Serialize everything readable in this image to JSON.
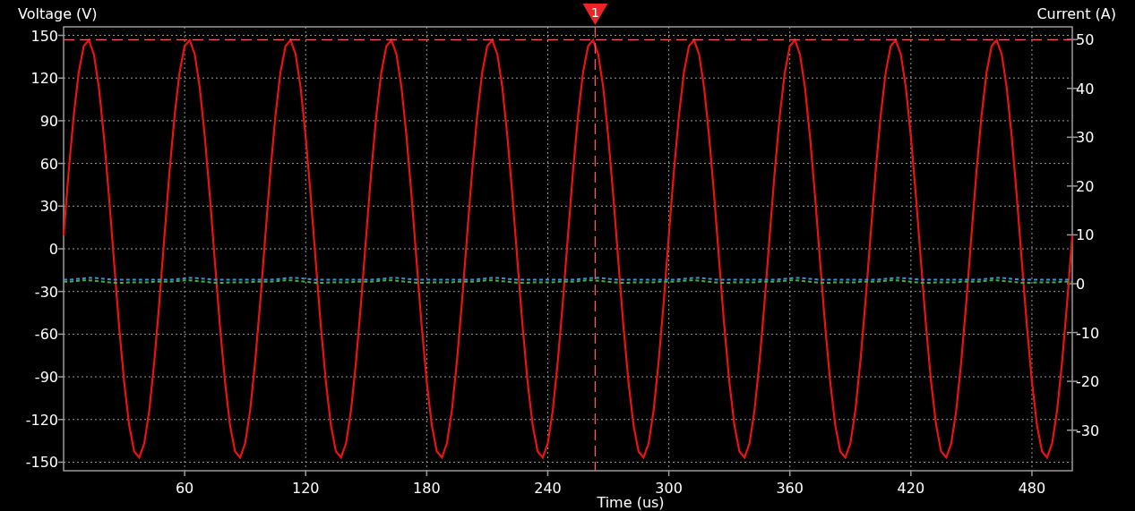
{
  "chart_data": {
    "type": "line",
    "grid": true,
    "ylabel": "Voltage (V)",
    "y2label": "Current (A)",
    "xlabel": "Time (us)",
    "xlim": [
      0,
      500
    ],
    "ylim": [
      -156,
      156
    ],
    "y2lim": [
      -38.3,
      52.6
    ],
    "xticks": [
      60,
      120,
      180,
      240,
      300,
      360,
      420,
      480
    ],
    "yticks": [
      -150,
      -120,
      -90,
      -60,
      -30,
      0,
      30,
      60,
      90,
      120,
      150
    ],
    "y2ticks": [
      -30,
      -20,
      -10,
      0,
      10,
      20,
      30,
      40,
      50
    ],
    "x": [
      0,
      2.5,
      5,
      7.5,
      10,
      12.5,
      15,
      17.5,
      20,
      22.5,
      25,
      27.5,
      30,
      32.5,
      35,
      37.5,
      40,
      42.5,
      45,
      47.5,
      50,
      52.5,
      55,
      57.5,
      60,
      62.5,
      65,
      67.5,
      70,
      72.5,
      75,
      77.5,
      80,
      82.5,
      85,
      87.5,
      90,
      92.5,
      95,
      97.5,
      100,
      102.5,
      105,
      107.5,
      110,
      112.5,
      115,
      117.5,
      120,
      122.5,
      125,
      127.5,
      130,
      132.5,
      135,
      137.5,
      140,
      142.5,
      145,
      147.5,
      150,
      152.5,
      155,
      157.5,
      160,
      162.5,
      165,
      167.5,
      170,
      172.5,
      175,
      177.5,
      180,
      182.5,
      185,
      187.5,
      190,
      192.5,
      195,
      197.5,
      200,
      202.5,
      205,
      207.5,
      210,
      212.5,
      215,
      217.5,
      220,
      222.5,
      225,
      227.5,
      230,
      232.5,
      235,
      237.5,
      240,
      242.5,
      245,
      247.5,
      250,
      252.5,
      255,
      257.5,
      260,
      262.5,
      265,
      267.5,
      270,
      272.5,
      275,
      277.5,
      280,
      282.5,
      285,
      287.5,
      290,
      292.5,
      295,
      297.5,
      300,
      302.5,
      305,
      307.5,
      310,
      312.5,
      315,
      317.5,
      320,
      322.5,
      325,
      327.5,
      330,
      332.5,
      335,
      337.5,
      340,
      342.5,
      345,
      347.5,
      350,
      352.5,
      355,
      357.5,
      360,
      362.5,
      365,
      367.5,
      370,
      372.5,
      375,
      377.5,
      380,
      382.5,
      385,
      387.5,
      390,
      392.5,
      395,
      397.5,
      400,
      402.5,
      405,
      407.5,
      410,
      412.5,
      415,
      417.5,
      420,
      422.5,
      425,
      427.5,
      430,
      432.5,
      435,
      437.5,
      440,
      442.5,
      445,
      447.5,
      450,
      452.5,
      455,
      457.5,
      460,
      462.5,
      465,
      467.5,
      470,
      472.5,
      475,
      477.5,
      480,
      482.5,
      485,
      487.5,
      490,
      492.5,
      495,
      497.5,
      500
    ],
    "series": [
      {
        "line_style": "solid",
        "color": "#ee1111",
        "values": [
          9.2,
          54.1,
          93.7,
          124.1,
          142.4,
          146.7,
          136.7,
          113.3,
          78.8,
          36.6,
          -9.2,
          -54.1,
          -93.7,
          -124.1,
          -142.4,
          -146.7,
          -136.7,
          -113.3,
          -78.8,
          -36.6,
          9.2,
          54.1,
          93.7,
          124.1,
          142.4,
          146.7,
          136.7,
          113.3,
          78.8,
          36.6,
          -9.2,
          -54.1,
          -93.7,
          -124.1,
          -142.4,
          -146.7,
          -136.7,
          -113.3,
          -78.8,
          -36.6,
          9.2,
          54.1,
          93.7,
          124.1,
          142.4,
          146.7,
          136.7,
          113.3,
          78.8,
          36.6,
          -9.2,
          -54.1,
          -93.7,
          -124.1,
          -142.4,
          -146.7,
          -136.7,
          -113.3,
          -78.8,
          -36.6,
          9.2,
          54.1,
          93.7,
          124.1,
          142.4,
          146.7,
          136.7,
          113.3,
          78.8,
          36.6,
          -9.2,
          -54.1,
          -93.7,
          -124.1,
          -142.4,
          -146.7,
          -136.7,
          -113.3,
          -78.8,
          -36.6,
          9.2,
          54.1,
          93.7,
          124.1,
          142.4,
          146.7,
          136.7,
          113.3,
          78.8,
          36.6,
          -9.2,
          -54.1,
          -93.7,
          -124.1,
          -142.4,
          -146.7,
          -136.7,
          -113.3,
          -78.8,
          -36.6,
          9.2,
          54.1,
          93.7,
          124.1,
          142.4,
          146.7,
          136.7,
          113.3,
          78.8,
          36.6,
          -9.2,
          -54.1,
          -93.7,
          -124.1,
          -142.4,
          -146.7,
          -136.7,
          -113.3,
          -78.8,
          -36.6,
          9.2,
          54.1,
          93.7,
          124.1,
          142.4,
          146.7,
          136.7,
          113.3,
          78.8,
          36.6,
          -9.2,
          -54.1,
          -93.7,
          -124.1,
          -142.4,
          -146.7,
          -136.7,
          -113.3,
          -78.8,
          -36.6,
          9.2,
          54.1,
          93.7,
          124.1,
          142.4,
          146.7,
          136.7,
          113.3,
          78.8,
          36.6,
          -9.2,
          -54.1,
          -93.7,
          -124.1,
          -142.4,
          -146.7,
          -136.7,
          -113.3,
          -78.8,
          -36.6,
          9.2,
          54.1,
          93.7,
          124.1,
          142.4,
          146.7,
          136.7,
          113.3,
          78.8,
          36.6,
          -9.2,
          -54.1,
          -93.7,
          -124.1,
          -142.4,
          -146.7,
          -136.7,
          -113.3,
          -78.8,
          -36.6,
          9.2,
          54.1,
          93.7,
          124.1,
          142.4,
          146.7,
          136.7,
          113.3,
          78.8,
          36.6,
          -9.2,
          -54.1,
          -93.7,
          -124.1,
          -142.4,
          -146.7,
          -136.7,
          -113.3,
          -78.8,
          -36.6,
          9.2
        ]
      },
      {
        "axis": "y2",
        "line_style": "dotted",
        "color": "#3a8fd0",
        "values": [
          0.8,
          0.8,
          0.9,
          1.0,
          1.1,
          1.2,
          1.2,
          1.1,
          1.0,
          0.9,
          0.8,
          0.8,
          0.8,
          0.8,
          0.8,
          0.8,
          0.8,
          0.8,
          0.8,
          0.8,
          0.8,
          0.8,
          0.9,
          1.0,
          1.1,
          1.2,
          1.2,
          1.1,
          1.0,
          0.9,
          0.8,
          0.8,
          0.8,
          0.8,
          0.8,
          0.8,
          0.8,
          0.8,
          0.8,
          0.8,
          0.8,
          0.8,
          0.9,
          1.0,
          1.1,
          1.2,
          1.2,
          1.1,
          1.0,
          0.9,
          0.8,
          0.8,
          0.8,
          0.8,
          0.8,
          0.8,
          0.8,
          0.8,
          0.8,
          0.8,
          0.8,
          0.8,
          0.9,
          1.0,
          1.1,
          1.2,
          1.2,
          1.1,
          1.0,
          0.9,
          0.8,
          0.8,
          0.8,
          0.8,
          0.8,
          0.8,
          0.8,
          0.8,
          0.8,
          0.8,
          0.8,
          0.8,
          0.9,
          1.0,
          1.1,
          1.2,
          1.2,
          1.1,
          1.0,
          0.9,
          0.8,
          0.8,
          0.8,
          0.8,
          0.8,
          0.8,
          0.8,
          0.8,
          0.8,
          0.8,
          0.8,
          0.8,
          0.9,
          1.0,
          1.1,
          1.2,
          1.2,
          1.1,
          1.0,
          0.9,
          0.8,
          0.8,
          0.8,
          0.8,
          0.8,
          0.8,
          0.8,
          0.8,
          0.8,
          0.8,
          0.8,
          0.8,
          0.9,
          1.0,
          1.1,
          1.2,
          1.2,
          1.1,
          1.0,
          0.9,
          0.8,
          0.8,
          0.8,
          0.8,
          0.8,
          0.8,
          0.8,
          0.8,
          0.8,
          0.8,
          0.8,
          0.8,
          0.9,
          1.0,
          1.1,
          1.2,
          1.2,
          1.1,
          1.0,
          0.9,
          0.8,
          0.8,
          0.8,
          0.8,
          0.8,
          0.8,
          0.8,
          0.8,
          0.8,
          0.8,
          0.8,
          0.8,
          0.9,
          1.0,
          1.1,
          1.2,
          1.2,
          1.1,
          1.0,
          0.9,
          0.8,
          0.8,
          0.8,
          0.8,
          0.8,
          0.8,
          0.8,
          0.8,
          0.8,
          0.8,
          0.8,
          0.8,
          0.9,
          1.0,
          1.1,
          1.2,
          1.2,
          1.1,
          1.0,
          0.9,
          0.8,
          0.8,
          0.8,
          0.8,
          0.8,
          0.8,
          0.8,
          0.8,
          0.8,
          0.8,
          0.8
        ]
      },
      {
        "axis": "y2",
        "line_style": "dotted",
        "color": "#44b044",
        "values": [
          0.4,
          0.4,
          0.5,
          0.6,
          0.7,
          0.7,
          0.6,
          0.5,
          0.4,
          0.3,
          0.2,
          0.2,
          0.2,
          0.3,
          0.3,
          0.3,
          0.3,
          0.3,
          0.4,
          0.4,
          0.4,
          0.4,
          0.5,
          0.6,
          0.7,
          0.7,
          0.6,
          0.5,
          0.4,
          0.3,
          0.2,
          0.2,
          0.2,
          0.3,
          0.3,
          0.3,
          0.3,
          0.3,
          0.4,
          0.4,
          0.4,
          0.4,
          0.5,
          0.6,
          0.7,
          0.7,
          0.6,
          0.5,
          0.4,
          0.3,
          0.2,
          0.2,
          0.2,
          0.3,
          0.3,
          0.3,
          0.3,
          0.3,
          0.4,
          0.4,
          0.4,
          0.4,
          0.5,
          0.6,
          0.7,
          0.7,
          0.6,
          0.5,
          0.4,
          0.3,
          0.2,
          0.2,
          0.2,
          0.3,
          0.3,
          0.3,
          0.3,
          0.3,
          0.4,
          0.4,
          0.4,
          0.4,
          0.5,
          0.6,
          0.7,
          0.7,
          0.6,
          0.5,
          0.4,
          0.3,
          0.2,
          0.2,
          0.2,
          0.3,
          0.3,
          0.3,
          0.3,
          0.3,
          0.4,
          0.4,
          0.4,
          0.4,
          0.5,
          0.6,
          0.7,
          0.7,
          0.6,
          0.5,
          0.4,
          0.3,
          0.2,
          0.2,
          0.2,
          0.3,
          0.3,
          0.3,
          0.3,
          0.3,
          0.4,
          0.4,
          0.4,
          0.4,
          0.5,
          0.6,
          0.7,
          0.7,
          0.6,
          0.5,
          0.4,
          0.3,
          0.2,
          0.2,
          0.2,
          0.3,
          0.3,
          0.3,
          0.3,
          0.3,
          0.4,
          0.4,
          0.4,
          0.4,
          0.5,
          0.6,
          0.7,
          0.7,
          0.6,
          0.5,
          0.4,
          0.3,
          0.2,
          0.2,
          0.2,
          0.3,
          0.3,
          0.3,
          0.3,
          0.3,
          0.4,
          0.4,
          0.4,
          0.4,
          0.5,
          0.6,
          0.7,
          0.7,
          0.6,
          0.5,
          0.4,
          0.3,
          0.2,
          0.2,
          0.2,
          0.3,
          0.3,
          0.3,
          0.3,
          0.3,
          0.4,
          0.4,
          0.4,
          0.4,
          0.5,
          0.6,
          0.7,
          0.7,
          0.6,
          0.5,
          0.4,
          0.3,
          0.2,
          0.2,
          0.2,
          0.3,
          0.3,
          0.3,
          0.3,
          0.3,
          0.4,
          0.4,
          0.4
        ]
      }
    ],
    "ref_lines": [
      {
        "axis": "y",
        "value": 147
      },
      {
        "axis": "x",
        "value": 263.5
      }
    ],
    "annotations": [
      {
        "text": "1",
        "x": 263.5
      }
    ]
  }
}
